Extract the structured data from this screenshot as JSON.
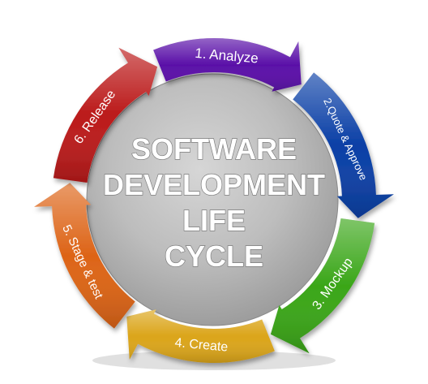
{
  "center": {
    "lines": [
      "SOFTWARE",
      "DEVELOPMENT",
      "LIFE",
      "CYCLE"
    ]
  },
  "steps": [
    {
      "label": "1. Analyze",
      "color": "#5a10a8"
    },
    {
      "label": "2.Quote & Approve",
      "color": "#0a3fa6"
    },
    {
      "label": "3. Mockup",
      "color": "#3aa618"
    },
    {
      "label": "4. Create",
      "color": "#dba51a"
    },
    {
      "label": "5. Stage & test",
      "color": "#dd6417"
    },
    {
      "label": "6. Release",
      "color": "#bb1a1a"
    }
  ]
}
